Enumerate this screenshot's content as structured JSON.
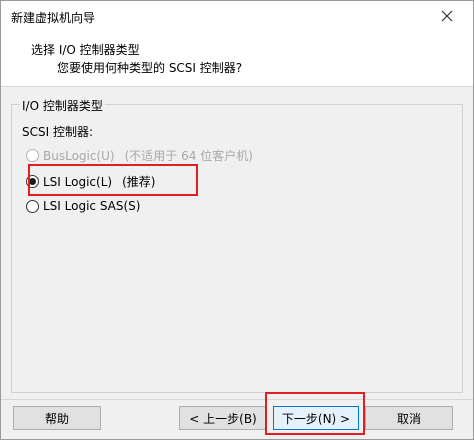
{
  "window": {
    "title": "新建虚拟机向导"
  },
  "header": {
    "title": "选择 I/O 控制器类型",
    "subtitle": "您要使用何种类型的 SCSI 控制器?"
  },
  "group": {
    "legend": "I/O 控制器类型",
    "label": "SCSI 控制器:",
    "options": [
      {
        "label": "BusLogic(U)",
        "note": "(不适用于 64 位客户机)",
        "checked": false,
        "enabled": false
      },
      {
        "label": "LSI Logic(L)",
        "note": "(推荐)",
        "checked": true,
        "enabled": true
      },
      {
        "label": "LSI Logic SAS(S)",
        "note": "",
        "checked": false,
        "enabled": true
      }
    ]
  },
  "buttons": {
    "help": "帮助",
    "back": "< 上一步(B)",
    "next": "下一步(N) >",
    "cancel": "取消"
  },
  "colors": {
    "annotation": "#e02020",
    "primary_border": "#0078d7"
  },
  "icons": {
    "close": "close-icon"
  }
}
